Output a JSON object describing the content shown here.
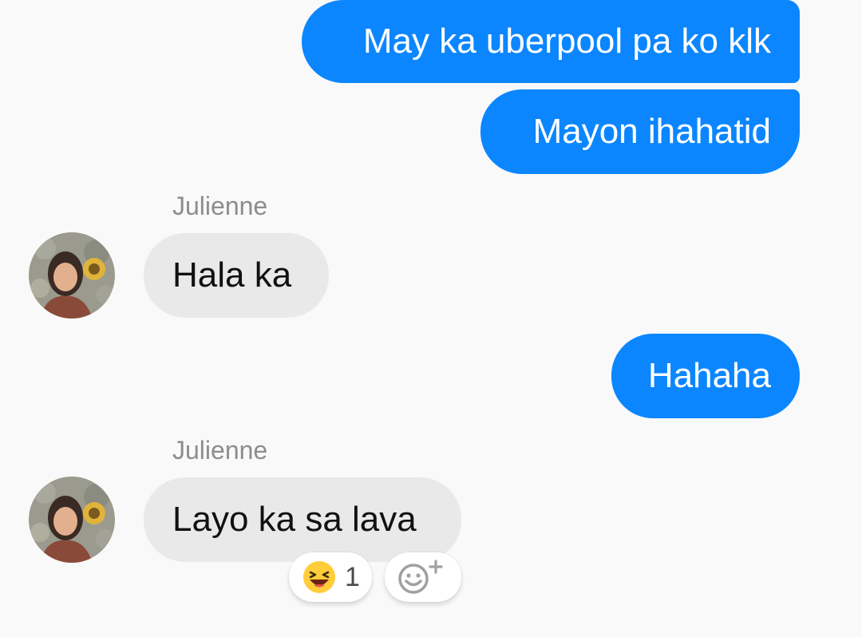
{
  "messages": [
    {
      "direction": "sent",
      "text": "May ka uberpool pa ko klk"
    },
    {
      "direction": "sent",
      "text": "Mayon ihahatid"
    },
    {
      "direction": "received",
      "sender": "Julienne",
      "text": "Hala ka"
    },
    {
      "direction": "sent",
      "text": "Hahaha"
    },
    {
      "direction": "received",
      "sender": "Julienne",
      "text": "Layo ka sa lava"
    }
  ],
  "reactions": {
    "emoji_icon": "laughing-face-icon",
    "count": "1",
    "add_icon": "add-reaction-icon"
  },
  "colors": {
    "sent_bubble": "#0b86ff",
    "received_bubble": "#e9e9e9",
    "background": "#f9f9f9",
    "sender_name": "#8d8d8d"
  }
}
